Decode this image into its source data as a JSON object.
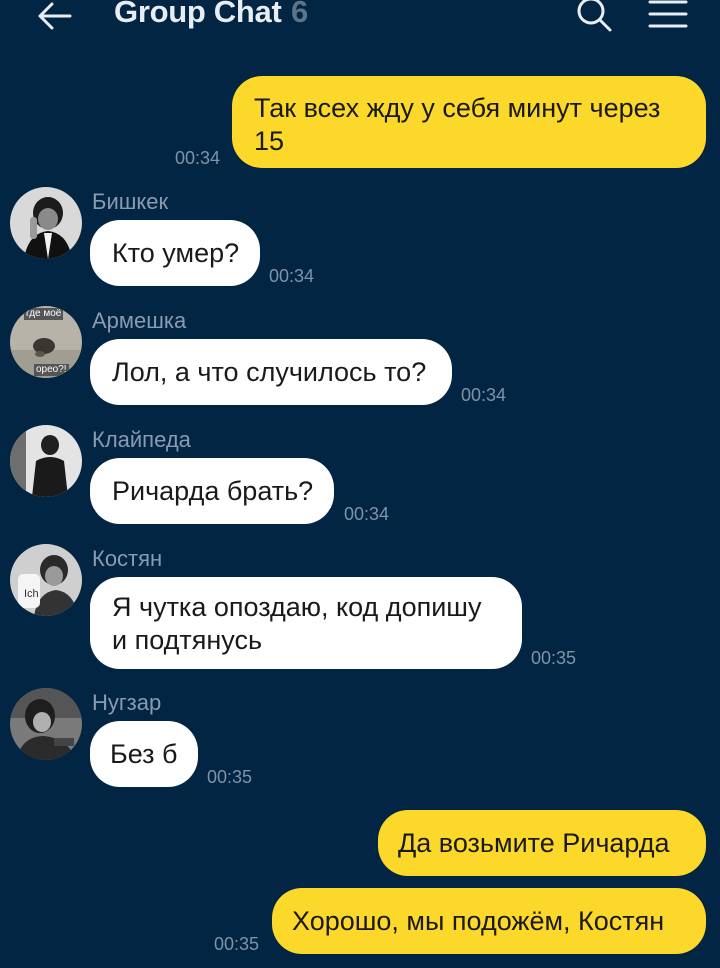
{
  "header": {
    "title": "Group Chat",
    "member_count": "6"
  },
  "messages": [
    {
      "id": "m1",
      "direction": "out",
      "text": "Так всех жду у себя минут через 15",
      "time": "00:34"
    },
    {
      "id": "m2",
      "direction": "in",
      "sender": "Бишкек",
      "text": "Кто умер?",
      "time": "00:34",
      "avatar": "bishkek-avatar"
    },
    {
      "id": "m3",
      "direction": "in",
      "sender": "Армешка",
      "text": "Лол, а что случилось то?",
      "time": "00:34",
      "avatar": "armeshka-avatar",
      "avatar_caption_top": "где моё",
      "avatar_caption_bottom": "орео?!"
    },
    {
      "id": "m4",
      "direction": "in",
      "sender": "Клайпеда",
      "text": "Ричарда брать?",
      "time": "00:34",
      "avatar": "klaipeda-avatar"
    },
    {
      "id": "m5",
      "direction": "in",
      "sender": "Костян",
      "text": "Я чутка опоздаю, код допишу и подтянусь",
      "time": "00:35",
      "avatar": "kostyan-avatar",
      "avatar_caption": "Ich"
    },
    {
      "id": "m6",
      "direction": "in",
      "sender": "Нугзар",
      "text": "Без б",
      "time": "00:35",
      "avatar": "nugzar-avatar"
    },
    {
      "id": "m7",
      "direction": "out",
      "text": "Да возьмите Ричарда",
      "time": ""
    },
    {
      "id": "m8",
      "direction": "out",
      "text": "Хорошо, мы подожём, Костян",
      "time": "00:35"
    }
  ],
  "colors": {
    "background": "#022543",
    "outgoing_bubble": "#fbd82a",
    "incoming_bubble": "#ffffff"
  },
  "icons": [
    "back-arrow-icon",
    "search-icon",
    "menu-icon"
  ]
}
